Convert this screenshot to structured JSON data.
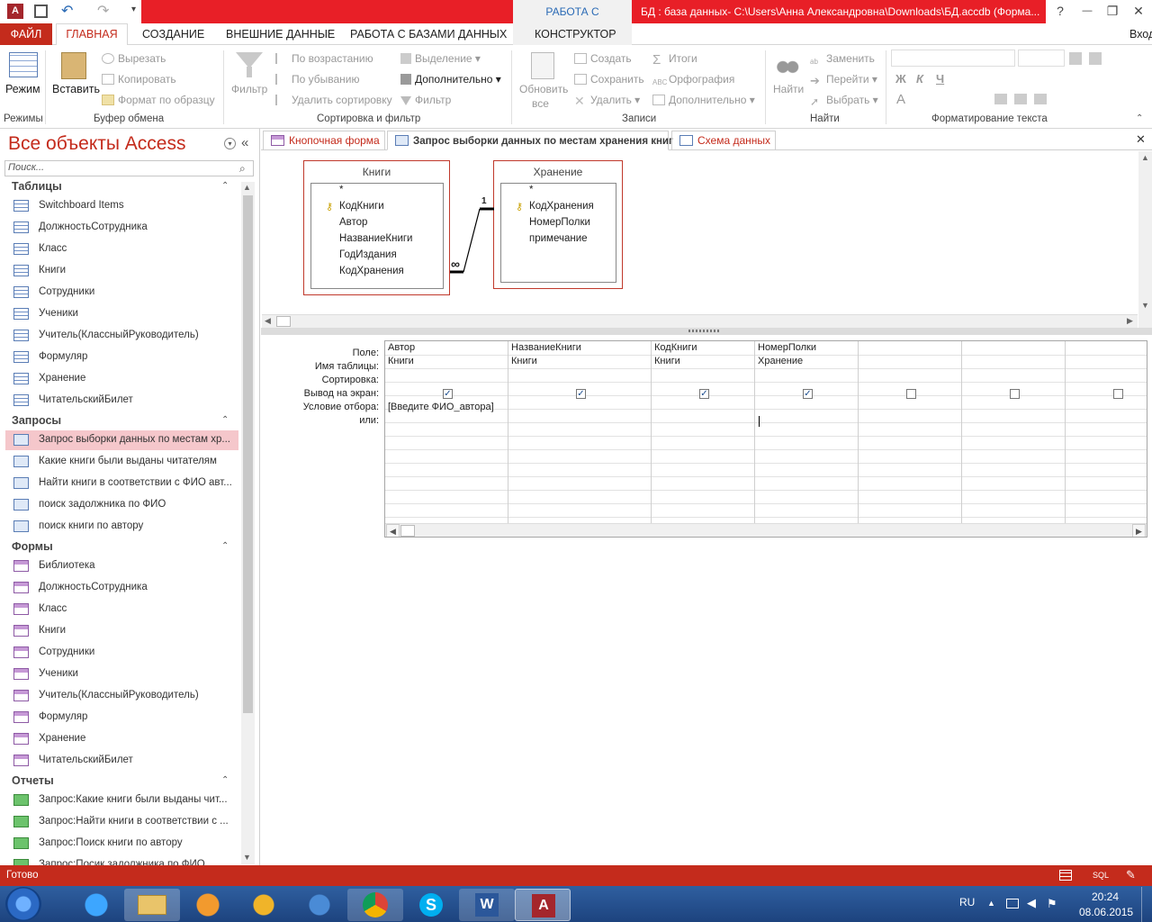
{
  "titlebar": {
    "context_tab": "РАБОТА С ЗАПРОСАМИ",
    "title": "БД : база данных- C:\\Users\\Анна Александровна\\Downloads\\БД.accdb (Форма...",
    "help": "?",
    "restore": "❐",
    "minimize": "—",
    "close": "✕"
  },
  "ribbon_tabs": {
    "file": "ФАЙЛ",
    "home": "ГЛАВНАЯ",
    "create": "СОЗДАНИЕ",
    "external": "ВНЕШНИЕ ДАННЫЕ",
    "dbtools": "РАБОТА С БАЗАМИ ДАННЫХ",
    "design": "КОНСТРУКТОР",
    "signin": "Вход"
  },
  "ribbon": {
    "views": {
      "mode": "Режим",
      "group": "Режимы"
    },
    "clipboard": {
      "paste": "Вставить",
      "cut": "Вырезать",
      "copy": "Копировать",
      "format": "Формат по образцу",
      "group": "Буфер обмена"
    },
    "sort": {
      "filter": "Фильтр",
      "asc": "По возрастанию",
      "desc": "По убыванию",
      "remove": "Удалить сортировку",
      "selection": "Выделение",
      "advanced": "Дополнительно",
      "toggle": "Фильтр",
      "group": "Сортировка и фильтр"
    },
    "records": {
      "refresh": "Обновить",
      "refresh2": "все",
      "new": "Создать",
      "save": "Сохранить",
      "delete": "Удалить",
      "totals": "Итоги",
      "spelling": "Орфография",
      "more": "Дополнительно",
      "group": "Записи"
    },
    "find": {
      "find": "Найти",
      "replace": "Заменить",
      "goto": "Перейти",
      "select": "Выбрать",
      "group": "Найти"
    },
    "text": {
      "bold": "Ж",
      "italic": "К",
      "underline": "Ч",
      "fontcolor": "A",
      "group": "Форматирование текста"
    }
  },
  "nav": {
    "title": "Все объекты Access",
    "search_placeholder": "Поиск...",
    "tables_header": "Таблицы",
    "tables": [
      "Switchboard Items",
      "ДолжностьСотрудника",
      "Класс",
      "Книги",
      "Сотрудники",
      "Ученики",
      "Учитель(КлассныйРуководитель)",
      "Формуляр",
      "Хранение",
      "ЧитательскийБилет"
    ],
    "queries_header": "Запросы",
    "queries": [
      "Запрос выборки данных по местам хр...",
      "Какие книги были выданы читателям",
      "Найти книги в соответствии с ФИО авт...",
      "поиск задолжника по ФИО",
      "поиск книги по автору"
    ],
    "forms_header": "Формы",
    "forms": [
      "Библиотека",
      "ДолжностьСотрудника",
      "Класс",
      "Книги",
      "Сотрудники",
      "Ученики",
      "Учитель(КлассныйРуководитель)",
      "Формуляр",
      "Хранение",
      "ЧитательскийБилет"
    ],
    "reports_header": "Отчеты",
    "reports": [
      "Запрос:Какие книги были выданы чит...",
      "Запрос:Найти книги в соответствии с ...",
      "Запрос:Поиск книги по автору",
      "Запрос:Посик задолжника по ФИО"
    ]
  },
  "doc_tabs": {
    "tab1": "Кнопочная форма",
    "tab2": "Запрос выборки данных по местам хранения книг",
    "tab3": "Схема данных",
    "close": "✕"
  },
  "diagram": {
    "table1": {
      "name": "Книги",
      "fields": [
        "*",
        "КодКниги",
        "Автор",
        "НазваниеКниги",
        "ГодИздания",
        "КодХранения"
      ]
    },
    "table2": {
      "name": "Хранение",
      "fields": [
        "*",
        "КодХранения",
        "НомерПолки",
        "примечание"
      ]
    },
    "rel_one": "1",
    "rel_many": "∞"
  },
  "grid": {
    "row_labels": [
      "Поле:",
      "Имя таблицы:",
      "Сортировка:",
      "Вывод на экран:",
      "Условие отбора:",
      "или:"
    ],
    "columns": [
      {
        "field": "Автор",
        "table": "Книги",
        "show": true,
        "criteria": "[Введите ФИО_автора]"
      },
      {
        "field": "НазваниеКниги",
        "table": "Книги",
        "show": true,
        "criteria": ""
      },
      {
        "field": "КодКниги",
        "table": "Книги",
        "show": true,
        "criteria": ""
      },
      {
        "field": "НомерПолки",
        "table": "Хранение",
        "show": true,
        "criteria": ""
      },
      {
        "field": "",
        "table": "",
        "show": false,
        "criteria": ""
      },
      {
        "field": "",
        "table": "",
        "show": false,
        "criteria": ""
      },
      {
        "field": "",
        "table": "",
        "show": false,
        "criteria": ""
      }
    ]
  },
  "status": {
    "text": "Готово",
    "sql": "SQL"
  },
  "taskbar": {
    "lang": "RU",
    "time": "20:24",
    "date": "08.06.2015"
  },
  "colors": {
    "accent": "#c42b1c",
    "title_red": "#e81f27",
    "taskbar": "#1d437e"
  }
}
